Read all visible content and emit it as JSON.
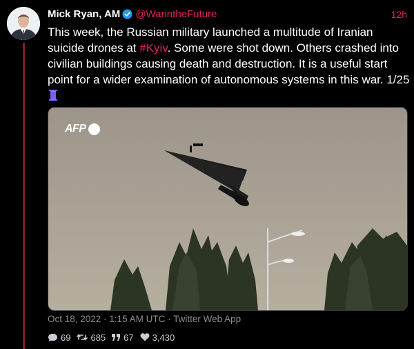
{
  "author": {
    "name": "Mick Ryan, AM",
    "handle": "@WarintheFuture",
    "verified": true
  },
  "tweet": {
    "time_ago": "12h",
    "text_before": "This week, the Russian military launched a multitude of Iranian suicide drones at ",
    "hashtag": "#Kyiv",
    "text_after": ". Some were shot down. Others crashed into civilian buildings causing death and destruction. It is a useful start point for a wider examination of autonomous systems in this war. 1/25",
    "timestamp": "Oct 18, 2022 · 1:15 AM UTC · Twitter Web App"
  },
  "media": {
    "watermark": "AFP"
  },
  "stats": {
    "replies": "69",
    "retweets": "685",
    "quotes": "67",
    "likes": "3,430"
  },
  "colors": {
    "accent": "#e0245e",
    "verified": "#1d9bf0",
    "thread_line": "#7a1f2b"
  }
}
